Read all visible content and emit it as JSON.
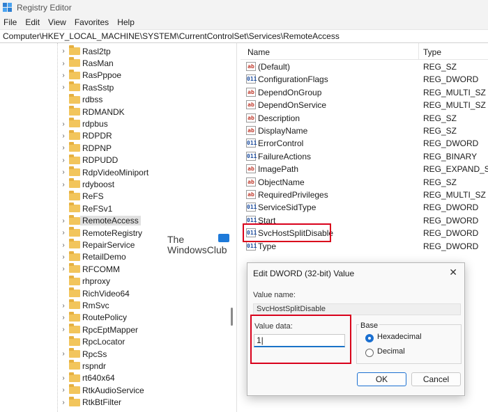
{
  "window": {
    "title": "Registry Editor"
  },
  "menu": [
    "File",
    "Edit",
    "View",
    "Favorites",
    "Help"
  ],
  "address": "Computer\\HKEY_LOCAL_MACHINE\\SYSTEM\\CurrentControlSet\\Services\\RemoteAccess",
  "tree": [
    {
      "label": "Rasl2tp",
      "expandable": true
    },
    {
      "label": "RasMan",
      "expandable": true
    },
    {
      "label": "RasPppoe",
      "expandable": true
    },
    {
      "label": "RasSstp",
      "expandable": true
    },
    {
      "label": "rdbss",
      "expandable": false
    },
    {
      "label": "RDMANDK",
      "expandable": false
    },
    {
      "label": "rdpbus",
      "expandable": true
    },
    {
      "label": "RDPDR",
      "expandable": true
    },
    {
      "label": "RDPNP",
      "expandable": true
    },
    {
      "label": "RDPUDD",
      "expandable": true
    },
    {
      "label": "RdpVideoMiniport",
      "expandable": true
    },
    {
      "label": "rdyboost",
      "expandable": true
    },
    {
      "label": "ReFS",
      "expandable": false
    },
    {
      "label": "ReFSv1",
      "expandable": false
    },
    {
      "label": "RemoteAccess",
      "expandable": true,
      "selected": true
    },
    {
      "label": "RemoteRegistry",
      "expandable": true
    },
    {
      "label": "RepairService",
      "expandable": true
    },
    {
      "label": "RetailDemo",
      "expandable": true
    },
    {
      "label": "RFCOMM",
      "expandable": true
    },
    {
      "label": "rhproxy",
      "expandable": false
    },
    {
      "label": "RichVideo64",
      "expandable": false
    },
    {
      "label": "RmSvc",
      "expandable": true
    },
    {
      "label": "RoutePolicy",
      "expandable": true
    },
    {
      "label": "RpcEptMapper",
      "expandable": true
    },
    {
      "label": "RpcLocator",
      "expandable": false
    },
    {
      "label": "RpcSs",
      "expandable": true
    },
    {
      "label": "rspndr",
      "expandable": false
    },
    {
      "label": "rt640x64",
      "expandable": true
    },
    {
      "label": "RtkAudioService",
      "expandable": true
    },
    {
      "label": "RtkBtFilter",
      "expandable": true
    }
  ],
  "list": {
    "col_name": "Name",
    "col_type": "Type",
    "rows": [
      {
        "name": "(Default)",
        "type": "REG_SZ",
        "icon": "ab"
      },
      {
        "name": "ConfigurationFlags",
        "type": "REG_DWORD",
        "icon": "bin"
      },
      {
        "name": "DependOnGroup",
        "type": "REG_MULTI_SZ",
        "icon": "ab"
      },
      {
        "name": "DependOnService",
        "type": "REG_MULTI_SZ",
        "icon": "ab"
      },
      {
        "name": "Description",
        "type": "REG_SZ",
        "icon": "ab"
      },
      {
        "name": "DisplayName",
        "type": "REG_SZ",
        "icon": "ab"
      },
      {
        "name": "ErrorControl",
        "type": "REG_DWORD",
        "icon": "bin"
      },
      {
        "name": "FailureActions",
        "type": "REG_BINARY",
        "icon": "bin"
      },
      {
        "name": "ImagePath",
        "type": "REG_EXPAND_SZ",
        "icon": "ab"
      },
      {
        "name": "ObjectName",
        "type": "REG_SZ",
        "icon": "ab"
      },
      {
        "name": "RequiredPrivileges",
        "type": "REG_MULTI_SZ",
        "icon": "ab"
      },
      {
        "name": "ServiceSidType",
        "type": "REG_DWORD",
        "icon": "bin"
      },
      {
        "name": "Start",
        "type": "REG_DWORD",
        "icon": "bin"
      },
      {
        "name": "SvcHostSplitDisable",
        "type": "REG_DWORD",
        "icon": "bin"
      },
      {
        "name": "Type",
        "type": "REG_DWORD",
        "icon": "bin"
      }
    ]
  },
  "watermark": {
    "line1": "The",
    "line2": "WindowsClub"
  },
  "dialog": {
    "title": "Edit DWORD (32-bit) Value",
    "close": "✕",
    "value_name_label": "Value name:",
    "value_name": "SvcHostSplitDisable",
    "value_data_label": "Value data:",
    "value_data": "1|",
    "base_label": "Base",
    "radio_hex": "Hexadecimal",
    "radio_dec": "Decimal",
    "selected_base": "Hexadecimal",
    "ok": "OK",
    "cancel": "Cancel"
  },
  "colors": {
    "highlight": "#d9001b",
    "accent": "#1a6fd0",
    "folder": "#f2c55c"
  }
}
